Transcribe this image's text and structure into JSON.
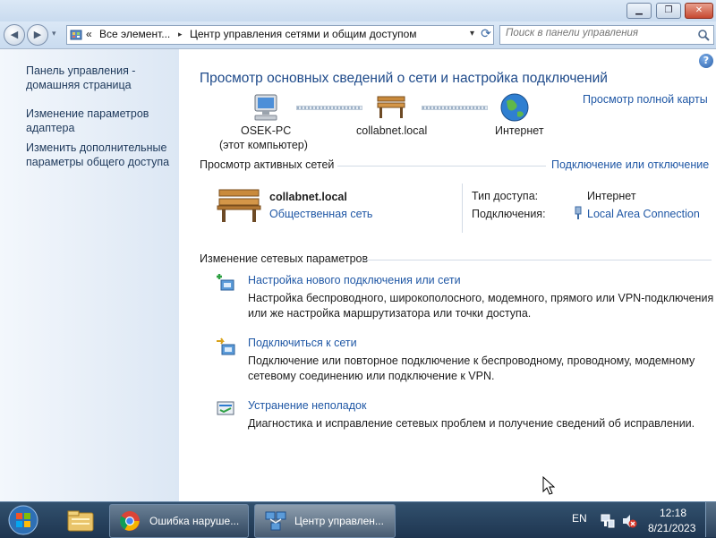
{
  "window": {
    "minimize": "▁",
    "maximize": "❐",
    "close": "✕"
  },
  "nav": {
    "back": "◀",
    "forward": "▶",
    "breadcrumb": [
      "«",
      "Все элемент...",
      "▸",
      "Центр управления сетями и общим доступом"
    ],
    "dropdown": "▾",
    "refresh": "⟳",
    "search_placeholder": "Поиск в панели управления"
  },
  "sidebar": {
    "items": [
      {
        "label": "Панель управления - домашняя страница"
      },
      {
        "label": "Изменение параметров адаптера"
      },
      {
        "label": "Изменить дополнительные параметры общего доступа"
      }
    ]
  },
  "main": {
    "help": "?",
    "title": "Просмотр основных сведений о сети и настройка подключений",
    "full_map": "Просмотр полной карты",
    "map": {
      "pc_name": "OSEK-PC",
      "pc_sub": "(этот компьютер)",
      "network": "collabnet.local",
      "internet": "Интернет"
    },
    "active": {
      "header": "Просмотр активных сетей",
      "connect_link": "Подключение или отключение",
      "name": "collabnet.local",
      "type": "Общественная сеть",
      "access_label": "Тип доступа:",
      "access_value": "Интернет",
      "conn_label": "Подключения:",
      "conn_value": "Local Area Connection"
    },
    "change": {
      "header": "Изменение сетевых параметров",
      "tasks": [
        {
          "title": "Настройка нового подключения или сети",
          "desc1": "Настройка беспроводного, широкополосного, модемного, прямого или VPN-подключения",
          "desc2": "или же настройка маршрутизатора или точки доступа."
        },
        {
          "title": "Подключиться к сети",
          "desc1": "Подключение или повторное подключение к беспроводному, проводному, модемному",
          "desc2": "сетевому соединению или подключение к VPN."
        },
        {
          "title": "Устранение неполадок",
          "desc1": "Диагностика и исправление сетевых проблем и получение сведений об исправлении.",
          "desc2": ""
        }
      ]
    }
  },
  "taskbar": {
    "chrome_label": "Ошибка наруше...",
    "netcenter_label": "Центр управлен...",
    "lang": "EN",
    "time": "12:18",
    "date": "8/21/2023"
  },
  "colors": {
    "link": "#1f57a5",
    "title": "#1e4a8a",
    "taskbar": "#1e3550"
  }
}
